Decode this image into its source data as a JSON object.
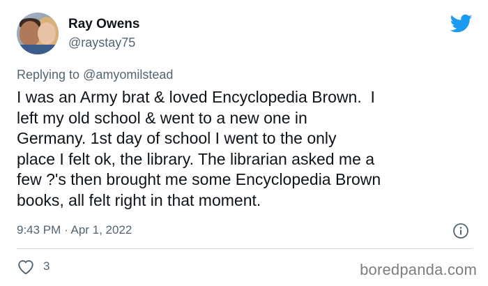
{
  "user": {
    "display_name": "Ray Owens",
    "handle": "@raystay75"
  },
  "reply": {
    "prefix": "Replying to ",
    "mention": "@amyomilstead"
  },
  "tweet": {
    "text": "I was an Army brat & loved Encyclopedia Brown.  I\nleft my old school & went to a new one in\nGermany. 1st day of school I went to the only\nplace I felt ok, the library. The librarian asked me a\nfew ?'s then brought me some Encyclopedia Brown\nbooks, all felt right in that moment.",
    "timestamp": "9:43 PM · Apr 1, 2022"
  },
  "actions": {
    "like_count": "3"
  },
  "watermark": "boredpanda.com",
  "icons": {
    "brand": "twitter-bird-icon",
    "info": "info-icon",
    "like": "heart-icon"
  },
  "colors": {
    "twitter_blue": "#1d9bf0",
    "text_primary": "#0f1419",
    "text_secondary": "#536471",
    "divider": "#cfd9de"
  }
}
